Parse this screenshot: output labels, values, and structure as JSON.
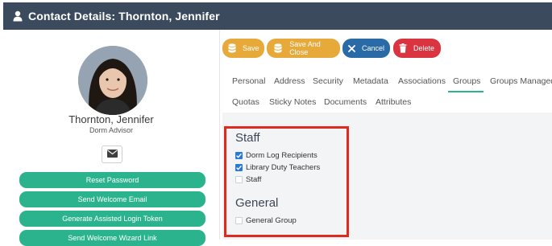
{
  "header": {
    "title": "Contact Details: Thornton, Jennifer",
    "icon": "user-icon"
  },
  "profile": {
    "name": "Thornton, Jennifer",
    "role": "Dorm Advisor",
    "mail_icon": "envelope-icon"
  },
  "actions": [
    "Reset Password",
    "Send Welcome Email",
    "Generate Assisted Login Token",
    "Send Welcome Wizard Link"
  ],
  "toolbar": {
    "save_label": "Save",
    "save_close_label": "Save And Close",
    "cancel_label": "Cancel",
    "delete_label": "Delete",
    "colors": {
      "save": "#e7a93a",
      "cancel": "#2a6aa6",
      "delete": "#d9343f"
    }
  },
  "tabs": {
    "row1": [
      "Personal",
      "Address",
      "Security",
      "Metadata",
      "Associations",
      "Groups",
      "Groups Managed"
    ],
    "row2": [
      "Quotas",
      "Sticky Notes",
      "Documents",
      "Attributes"
    ],
    "active": "Groups"
  },
  "groups": {
    "staff": {
      "title": "Staff",
      "items": [
        {
          "label": "Dorm Log Recipients",
          "checked": true
        },
        {
          "label": "Library Duty Teachers",
          "checked": true
        },
        {
          "label": "Staff",
          "checked": false
        }
      ]
    },
    "general": {
      "title": "General",
      "items": [
        {
          "label": "General Group",
          "checked": false
        }
      ]
    }
  },
  "colors": {
    "accent": "#2bb38d",
    "header_bg": "#3b4a5c",
    "highlight": "#e02a20"
  }
}
